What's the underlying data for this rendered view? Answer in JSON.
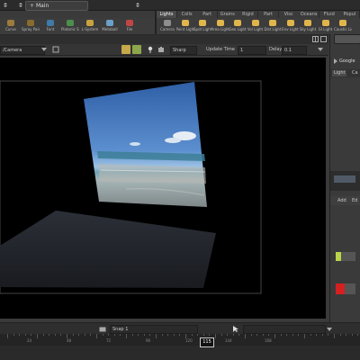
{
  "desktop": {
    "label": "Main"
  },
  "shelf_tabs": [
    "Lights",
    "Colls",
    "Part",
    "Grains",
    "Rigid",
    "Part",
    "Visc",
    "Oceans",
    "Fluid",
    "Popul"
  ],
  "shelf_tools": [
    {
      "icon": "curve-icon",
      "label": "Curve",
      "color": "#9c7b3b"
    },
    {
      "icon": "spray-paint-icon",
      "label": "Spray Paint",
      "color": "#8a6b2e"
    },
    {
      "icon": "font-icon",
      "label": "Font",
      "color": "#3f7aa8"
    },
    {
      "icon": "platonic-solids-icon",
      "label": "Platonic Solids",
      "color": "#4b8f4b"
    },
    {
      "icon": "l-system-icon",
      "label": "L-System",
      "color": "#c8a23f"
    },
    {
      "icon": "metaball-icon",
      "label": "Metaball",
      "color": "#6aa0c8"
    },
    {
      "icon": "file-icon",
      "label": "File",
      "color": "#c24545"
    }
  ],
  "light_tools": [
    {
      "icon": "camera-icon",
      "label": "Camera",
      "color": "#8e8e8e"
    },
    {
      "icon": "point-light-icon",
      "label": "Point Light",
      "color": "#e0b64c"
    },
    {
      "icon": "spot-light-icon",
      "label": "Spot Light",
      "color": "#e0b64c"
    },
    {
      "icon": "area-light-icon",
      "label": "Area Light",
      "color": "#e0b64c"
    },
    {
      "icon": "geometry-light-icon",
      "label": "Geo Light",
      "color": "#e0b64c"
    },
    {
      "icon": "volume-light-icon",
      "label": "Vol Light",
      "color": "#e0b64c"
    },
    {
      "icon": "distant-light-icon",
      "label": "Dist Light",
      "color": "#e0b64c"
    },
    {
      "icon": "environment-light-icon",
      "label": "Env Light",
      "color": "#e0b64c"
    },
    {
      "icon": "sky-light-icon",
      "label": "Sky Light",
      "color": "#e0b64c"
    },
    {
      "icon": "gi-light-icon",
      "label": "GI Light",
      "color": "#e0b64c"
    },
    {
      "icon": "caustic-light-icon",
      "label": "Caustic Light",
      "color": "#e0b64c"
    }
  ],
  "viewer": {
    "camera": "/Camera",
    "snap_mode": "Sharp",
    "update_label": "Update Time",
    "update_value": "1",
    "delay_label": "Delay",
    "delay_value": "0.1"
  },
  "right_panel": {
    "tab": "Google",
    "subtabs": [
      "Light",
      "Ca"
    ],
    "add_label": "Add",
    "edit_label": "Ed"
  },
  "time_bar": {
    "snap_label": "Snap",
    "snap_value": "1"
  },
  "timeline": {
    "current_frame": "115",
    "tick_labels": [
      "24",
      "48",
      "72",
      "96",
      "120",
      "144",
      "168"
    ]
  }
}
